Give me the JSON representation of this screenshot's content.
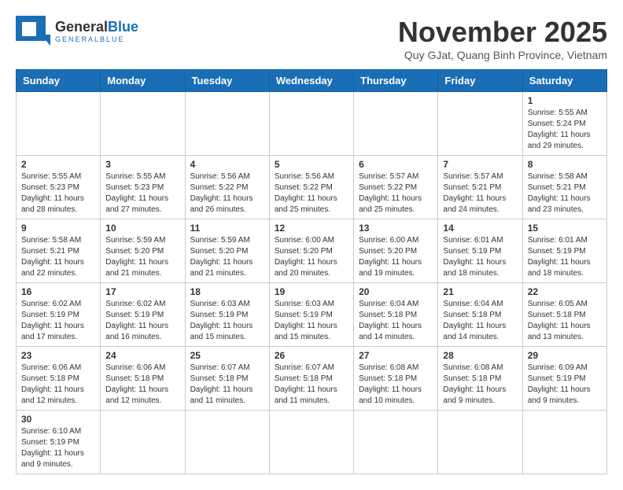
{
  "logo": {
    "general": "General",
    "blue": "Blue",
    "tagline": "GENERALBLUE"
  },
  "header": {
    "month": "November 2025",
    "location": "Quy GJat, Quang Binh Province, Vietnam"
  },
  "days_of_week": [
    "Sunday",
    "Monday",
    "Tuesday",
    "Wednesday",
    "Thursday",
    "Friday",
    "Saturday"
  ],
  "weeks": [
    {
      "cells": [
        {
          "num": "",
          "info": ""
        },
        {
          "num": "",
          "info": ""
        },
        {
          "num": "",
          "info": ""
        },
        {
          "num": "",
          "info": ""
        },
        {
          "num": "",
          "info": ""
        },
        {
          "num": "",
          "info": ""
        },
        {
          "num": "1",
          "info": "Sunrise: 5:55 AM\nSunset: 5:24 PM\nDaylight: 11 hours\nand 29 minutes."
        }
      ]
    },
    {
      "cells": [
        {
          "num": "2",
          "info": "Sunrise: 5:55 AM\nSunset: 5:23 PM\nDaylight: 11 hours\nand 28 minutes."
        },
        {
          "num": "3",
          "info": "Sunrise: 5:55 AM\nSunset: 5:23 PM\nDaylight: 11 hours\nand 27 minutes."
        },
        {
          "num": "4",
          "info": "Sunrise: 5:56 AM\nSunset: 5:22 PM\nDaylight: 11 hours\nand 26 minutes."
        },
        {
          "num": "5",
          "info": "Sunrise: 5:56 AM\nSunset: 5:22 PM\nDaylight: 11 hours\nand 25 minutes."
        },
        {
          "num": "6",
          "info": "Sunrise: 5:57 AM\nSunset: 5:22 PM\nDaylight: 11 hours\nand 25 minutes."
        },
        {
          "num": "7",
          "info": "Sunrise: 5:57 AM\nSunset: 5:21 PM\nDaylight: 11 hours\nand 24 minutes."
        },
        {
          "num": "8",
          "info": "Sunrise: 5:58 AM\nSunset: 5:21 PM\nDaylight: 11 hours\nand 23 minutes."
        }
      ]
    },
    {
      "cells": [
        {
          "num": "9",
          "info": "Sunrise: 5:58 AM\nSunset: 5:21 PM\nDaylight: 11 hours\nand 22 minutes."
        },
        {
          "num": "10",
          "info": "Sunrise: 5:59 AM\nSunset: 5:20 PM\nDaylight: 11 hours\nand 21 minutes."
        },
        {
          "num": "11",
          "info": "Sunrise: 5:59 AM\nSunset: 5:20 PM\nDaylight: 11 hours\nand 21 minutes."
        },
        {
          "num": "12",
          "info": "Sunrise: 6:00 AM\nSunset: 5:20 PM\nDaylight: 11 hours\nand 20 minutes."
        },
        {
          "num": "13",
          "info": "Sunrise: 6:00 AM\nSunset: 5:20 PM\nDaylight: 11 hours\nand 19 minutes."
        },
        {
          "num": "14",
          "info": "Sunrise: 6:01 AM\nSunset: 5:19 PM\nDaylight: 11 hours\nand 18 minutes."
        },
        {
          "num": "15",
          "info": "Sunrise: 6:01 AM\nSunset: 5:19 PM\nDaylight: 11 hours\nand 18 minutes."
        }
      ]
    },
    {
      "cells": [
        {
          "num": "16",
          "info": "Sunrise: 6:02 AM\nSunset: 5:19 PM\nDaylight: 11 hours\nand 17 minutes."
        },
        {
          "num": "17",
          "info": "Sunrise: 6:02 AM\nSunset: 5:19 PM\nDaylight: 11 hours\nand 16 minutes."
        },
        {
          "num": "18",
          "info": "Sunrise: 6:03 AM\nSunset: 5:19 PM\nDaylight: 11 hours\nand 15 minutes."
        },
        {
          "num": "19",
          "info": "Sunrise: 6:03 AM\nSunset: 5:19 PM\nDaylight: 11 hours\nand 15 minutes."
        },
        {
          "num": "20",
          "info": "Sunrise: 6:04 AM\nSunset: 5:18 PM\nDaylight: 11 hours\nand 14 minutes."
        },
        {
          "num": "21",
          "info": "Sunrise: 6:04 AM\nSunset: 5:18 PM\nDaylight: 11 hours\nand 14 minutes."
        },
        {
          "num": "22",
          "info": "Sunrise: 6:05 AM\nSunset: 5:18 PM\nDaylight: 11 hours\nand 13 minutes."
        }
      ]
    },
    {
      "cells": [
        {
          "num": "23",
          "info": "Sunrise: 6:06 AM\nSunset: 5:18 PM\nDaylight: 11 hours\nand 12 minutes."
        },
        {
          "num": "24",
          "info": "Sunrise: 6:06 AM\nSunset: 5:18 PM\nDaylight: 11 hours\nand 12 minutes."
        },
        {
          "num": "25",
          "info": "Sunrise: 6:07 AM\nSunset: 5:18 PM\nDaylight: 11 hours\nand 11 minutes."
        },
        {
          "num": "26",
          "info": "Sunrise: 6:07 AM\nSunset: 5:18 PM\nDaylight: 11 hours\nand 11 minutes."
        },
        {
          "num": "27",
          "info": "Sunrise: 6:08 AM\nSunset: 5:18 PM\nDaylight: 11 hours\nand 10 minutes."
        },
        {
          "num": "28",
          "info": "Sunrise: 6:08 AM\nSunset: 5:18 PM\nDaylight: 11 hours\nand 9 minutes."
        },
        {
          "num": "29",
          "info": "Sunrise: 6:09 AM\nSunset: 5:19 PM\nDaylight: 11 hours\nand 9 minutes."
        }
      ]
    },
    {
      "cells": [
        {
          "num": "30",
          "info": "Sunrise: 6:10 AM\nSunset: 5:19 PM\nDaylight: 11 hours\nand 9 minutes."
        },
        {
          "num": "",
          "info": ""
        },
        {
          "num": "",
          "info": ""
        },
        {
          "num": "",
          "info": ""
        },
        {
          "num": "",
          "info": ""
        },
        {
          "num": "",
          "info": ""
        },
        {
          "num": "",
          "info": ""
        }
      ]
    }
  ]
}
